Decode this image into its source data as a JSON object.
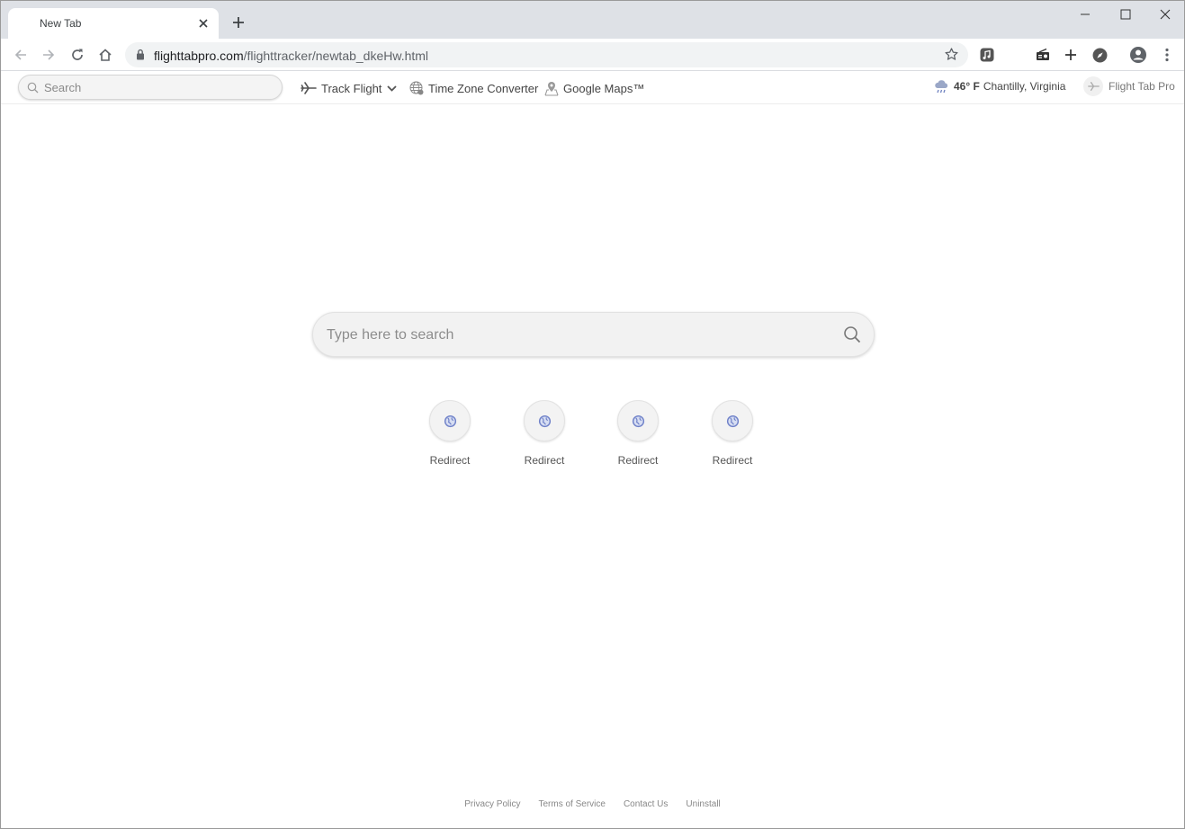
{
  "browser": {
    "tab_title": "New Tab",
    "url_host": "flighttabpro.com",
    "url_path": "/flighttracker/newtab_dkeHw.html"
  },
  "extension_bar": {
    "search_placeholder": "Search",
    "track_flight": "Track Flight",
    "time_zone": "Time Zone Converter",
    "maps": "Google Maps™",
    "weather_temp": "46° F",
    "weather_location": "Chantilly, Virginia",
    "brand": "Flight Tab Pro"
  },
  "main": {
    "search_placeholder": "Type here to search",
    "shortcuts": [
      {
        "label": "Redirect"
      },
      {
        "label": "Redirect"
      },
      {
        "label": "Redirect"
      },
      {
        "label": "Redirect"
      }
    ]
  },
  "footer": {
    "links": [
      "Privacy Policy",
      "Terms of Service",
      "Contact Us",
      "Uninstall"
    ]
  },
  "colors": {
    "tabstrip": "#dee1e6",
    "omnibox": "#f1f3f4",
    "shortcut_icon": "#6e80c8"
  },
  "icons": [
    "close-icon",
    "plus-icon",
    "minimize-icon",
    "maximize-icon",
    "back-icon",
    "forward-icon",
    "reload-icon",
    "home-icon",
    "lock-icon",
    "star-icon",
    "music-icon",
    "radio-icon",
    "compass-icon",
    "profile-icon",
    "menu-icon",
    "search-icon",
    "plane-icon",
    "chevron-down-icon",
    "globe-icon",
    "map-pin-icon",
    "weather-icon"
  ]
}
